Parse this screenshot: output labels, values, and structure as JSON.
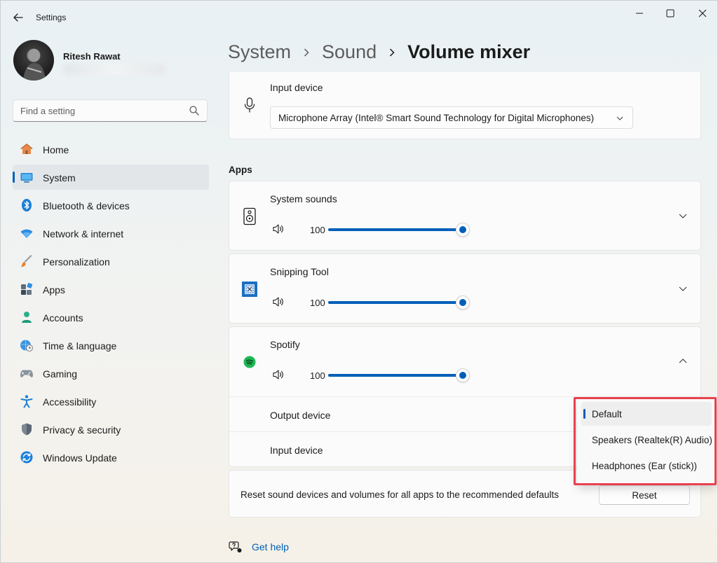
{
  "window": {
    "title": "Settings"
  },
  "user": {
    "name": "Ritesh Rawat"
  },
  "search": {
    "placeholder": "Find a setting"
  },
  "nav": [
    {
      "label": "Home",
      "icon": "home-icon",
      "selected": false
    },
    {
      "label": "System",
      "icon": "monitor-icon",
      "selected": true
    },
    {
      "label": "Bluetooth & devices",
      "icon": "bluetooth-icon",
      "selected": false
    },
    {
      "label": "Network & internet",
      "icon": "wifi-icon",
      "selected": false
    },
    {
      "label": "Personalization",
      "icon": "brush-icon",
      "selected": false
    },
    {
      "label": "Apps",
      "icon": "apps-icon",
      "selected": false
    },
    {
      "label": "Accounts",
      "icon": "person-icon",
      "selected": false
    },
    {
      "label": "Time & language",
      "icon": "clock-globe-icon",
      "selected": false
    },
    {
      "label": "Gaming",
      "icon": "gamepad-icon",
      "selected": false
    },
    {
      "label": "Accessibility",
      "icon": "accessibility-icon",
      "selected": false
    },
    {
      "label": "Privacy & security",
      "icon": "shield-icon",
      "selected": false
    },
    {
      "label": "Windows Update",
      "icon": "update-icon",
      "selected": false
    }
  ],
  "breadcrumb": {
    "items": [
      "System",
      "Sound",
      "Volume mixer"
    ]
  },
  "input_device": {
    "label": "Input device",
    "value": "Microphone Array (Intel® Smart Sound Technology for Digital Microphones)"
  },
  "apps": {
    "section_title": "Apps",
    "items": [
      {
        "name": "System sounds",
        "volume": 100,
        "expanded": false,
        "icon": "speaker-box-icon"
      },
      {
        "name": "Snipping Tool",
        "volume": 100,
        "expanded": false,
        "icon": "snipping-tool-icon"
      },
      {
        "name": "Spotify",
        "volume": 100,
        "expanded": true,
        "icon": "spotify-icon",
        "output_label": "Output device",
        "input_label": "Input device"
      }
    ]
  },
  "dropdown": {
    "options": [
      "Default",
      "Speakers (Realtek(R) Audio)",
      "Headphones (Ear (stick))"
    ],
    "selected": "Default"
  },
  "reset": {
    "text": "Reset sound devices and volumes for all apps to the recommended defaults",
    "button": "Reset"
  },
  "help": {
    "label": "Get help"
  },
  "colors": {
    "accent": "#005fb8",
    "highlight": "#e8414e"
  }
}
